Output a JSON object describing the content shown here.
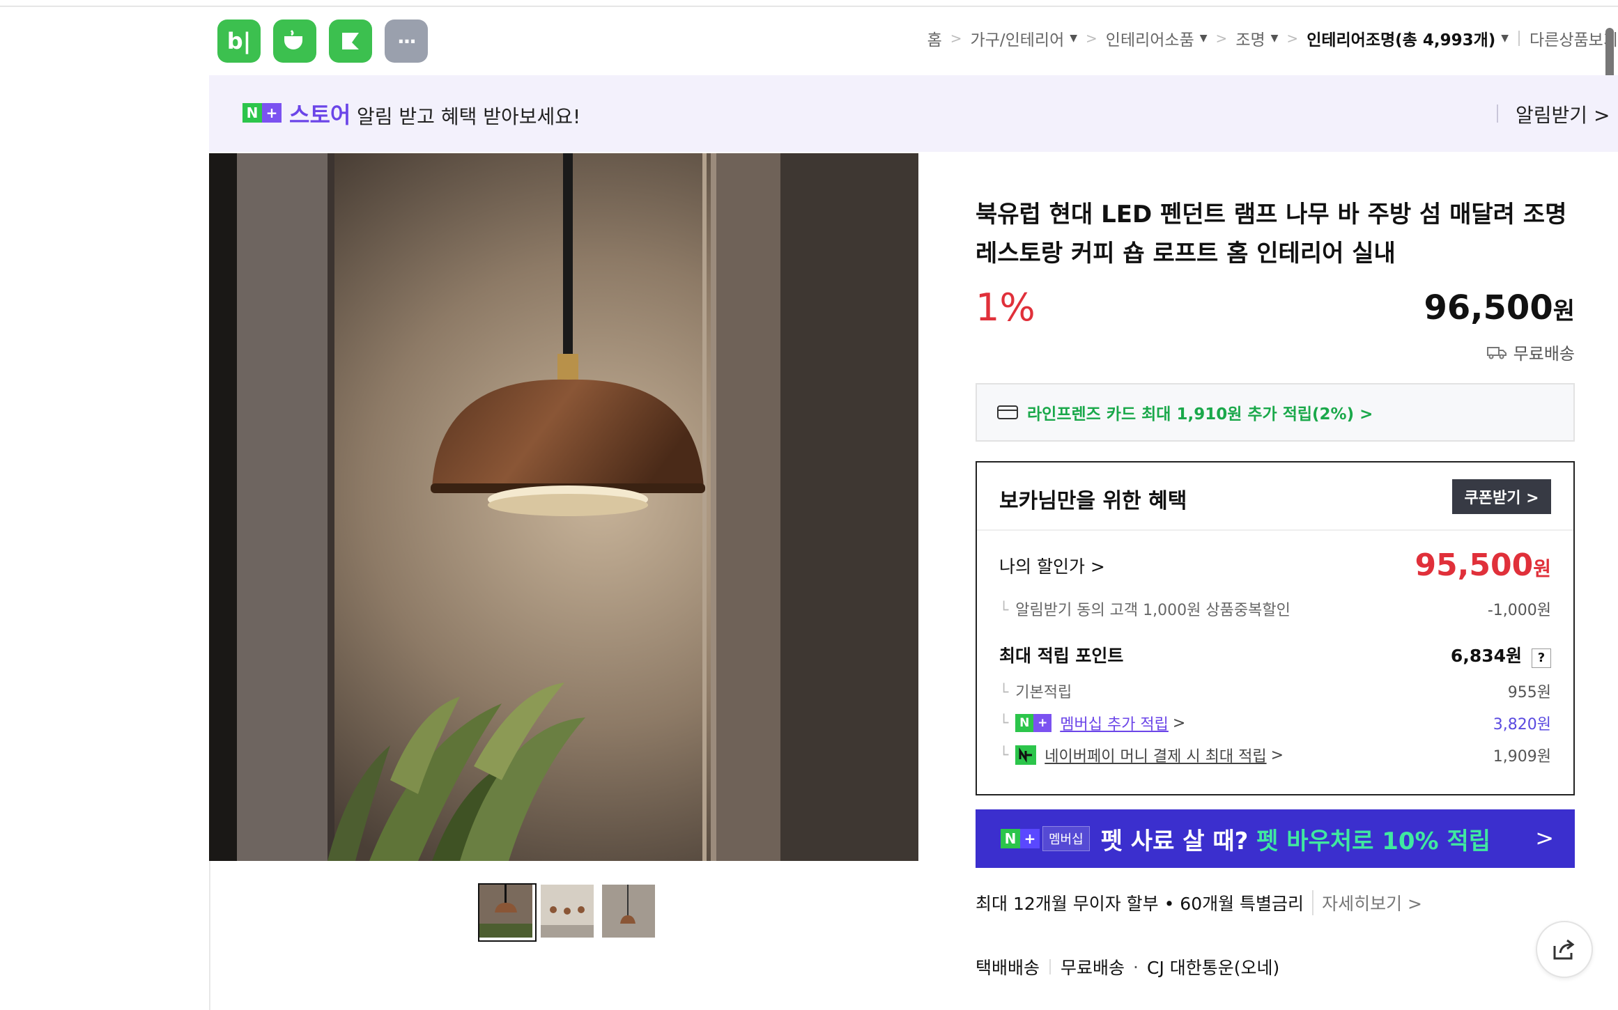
{
  "apps": [
    {
      "name": "blog",
      "label": "b|"
    },
    {
      "name": "cafe",
      "label": ""
    },
    {
      "name": "webtoon",
      "label": ""
    },
    {
      "name": "more",
      "label": "···"
    }
  ],
  "breadcrumb": {
    "home": "홈",
    "items": [
      "가구/인테리어",
      "인테리어소품",
      "조명"
    ],
    "current": "인테리어조명(총 4,993개)",
    "other": "다른상품보기"
  },
  "banner": {
    "n_label": "N",
    "plus_label": "+",
    "store_label": "스토어",
    "message": "알림 받고 혜택 받아보세요!",
    "subscribe_label": "알림받기 >"
  },
  "product": {
    "title": "북유럽 현대 LED 펜던트 램프 나무 바 주방 섬 매달려 조명 레스토랑 커피 숍 로프트 홈 인테리어 실내",
    "discount": "1%",
    "price": "96,500",
    "currency": "원",
    "shipping": "무료배송"
  },
  "card_promo": "라인프렌즈 카드 최대 1,910원 추가 적립(2%) >",
  "benefit": {
    "title": "보카님만을 위한 혜택",
    "coupon_button": "쿠폰받기 >",
    "my_price_label": "나의 할인가 >",
    "my_price_value": "95,500",
    "my_price_unit": "원",
    "discount_detail_label": "알림받기 동의 고객 1,000원 상품중복할인",
    "discount_detail_value": "-1,000원",
    "points_label": "최대 적립 포인트",
    "points_value": "6,834원",
    "points_help": "?",
    "basic_label": "기본적립",
    "basic_value": "955원",
    "membership_label": "멤버십 추가 적립",
    "membership_value": "3,820원",
    "npay_label": "네이버페이 머니 결제 시 최대 적립",
    "npay_value": "1,909원"
  },
  "pet_banner": {
    "badge": "멤버십",
    "text_white": "펫 사료 살 때?",
    "text_green": "펫 바우처로 10% 적립",
    "arrow": ">"
  },
  "installment": {
    "text": "최대 12개월 무이자 할부 • 60개월 특별금리",
    "more": "자세히보기 >"
  },
  "delivery": {
    "type": "택배배송",
    "fee": "무료배송",
    "carrier": "CJ 대한통운(오네)"
  },
  "colors": {
    "accent_green": "#2cc54b",
    "accent_purple": "#6b45e8",
    "price_red": "#e0303a",
    "pet_banner_bg": "#3b2fce"
  }
}
